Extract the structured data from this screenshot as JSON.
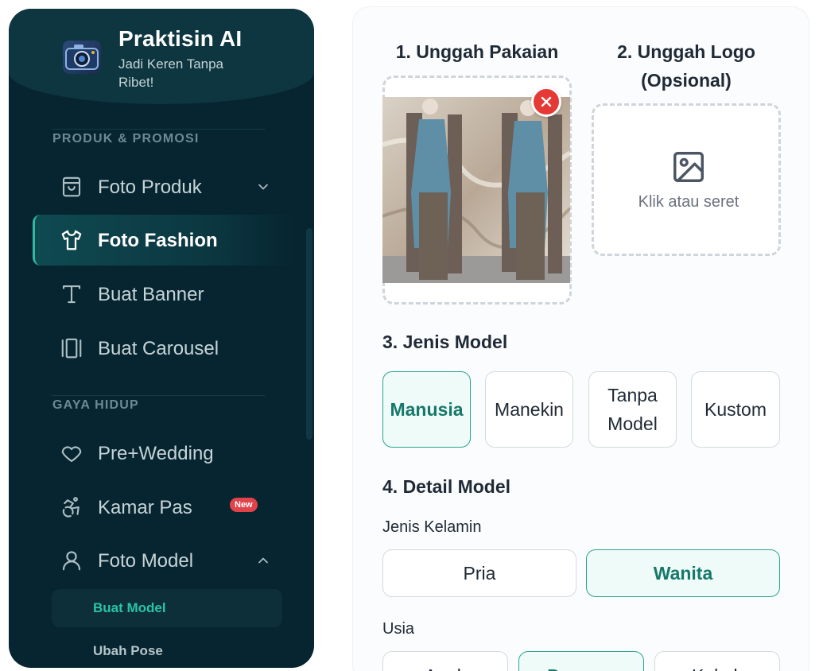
{
  "brand": {
    "title": "Praktisin AI",
    "subtitle": "Jadi Keren Tanpa Ribet!"
  },
  "sidebar": {
    "sections": [
      {
        "label": "PRODUK & PROMOSI"
      },
      {
        "label": "GAYA HIDUP"
      }
    ],
    "items": [
      {
        "label": "Foto Produk",
        "icon": "shopping-bag-icon",
        "expandable": true,
        "expanded": false
      },
      {
        "label": "Foto Fashion",
        "icon": "shirt-icon",
        "active": true
      },
      {
        "label": "Buat Banner",
        "icon": "text-type-icon"
      },
      {
        "label": "Buat Carousel",
        "icon": "carousel-icon"
      },
      {
        "label": "Pre+Wedding",
        "icon": "heart-icon"
      },
      {
        "label": "Kamar Pas",
        "icon": "accessibility-icon",
        "badge": "New"
      },
      {
        "label": "Foto Model",
        "icon": "user-icon",
        "expandable": true,
        "expanded": true
      }
    ],
    "subitems": [
      {
        "label": "Buat Model",
        "active": true
      },
      {
        "label": "Ubah Pose"
      }
    ]
  },
  "main": {
    "step1": {
      "title": "1. Unggah Pakaian"
    },
    "step2": {
      "title": "2. Unggah Logo (Opsional)",
      "drop_text": "Klik atau seret"
    },
    "step3": {
      "title": "3. Jenis Model",
      "options": [
        "Manusia",
        "Manekin",
        "Tanpa Model",
        "Kustom"
      ],
      "selected": "Manusia"
    },
    "step4": {
      "title": "4. Detail Model",
      "gender": {
        "label": "Jenis Kelamin",
        "options": [
          "Pria",
          "Wanita"
        ],
        "selected": "Wanita"
      },
      "age": {
        "label": "Usia",
        "options": [
          "Anak",
          "Dewasa",
          "Kakek"
        ],
        "selected": "Dewasa"
      }
    }
  },
  "colors": {
    "sidebar_bg": "#062530",
    "accent": "#2fb9a0",
    "selected_text": "#16786a",
    "badge": "#e2434b",
    "remove": "#e53935"
  }
}
